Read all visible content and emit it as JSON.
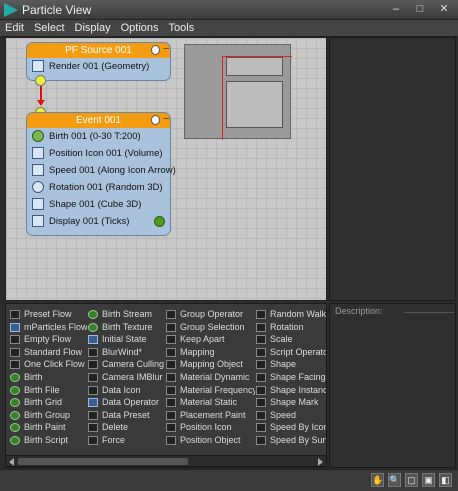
{
  "window": {
    "title": "Particle View"
  },
  "window_buttons": {
    "minimize": "–",
    "maximize": "□",
    "close": "✕"
  },
  "menu": [
    "Edit",
    "Select",
    "Display",
    "Options",
    "Tools"
  ],
  "nodes": {
    "source": {
      "title": "PF Source 001",
      "operators": [
        {
          "label": "Render 001 (Geometry)",
          "icon": "render-icon"
        }
      ]
    },
    "event": {
      "title": "Event 001",
      "operators": [
        {
          "label": "Birth 001 (0-30 T:200)",
          "icon": "birth-icon"
        },
        {
          "label": "Position Icon 001 (Volume)",
          "icon": "position-icon"
        },
        {
          "label": "Speed 001 (Along Icon Arrow)",
          "icon": "speed-icon"
        },
        {
          "label": "Rotation 001 (Random 3D)",
          "icon": "rotation-icon"
        },
        {
          "label": "Shape 001 (Cube 3D)",
          "icon": "shape-icon"
        },
        {
          "label": "Display 001 (Ticks)",
          "icon": "display-icon"
        }
      ]
    }
  },
  "depot": {
    "columns": [
      [
        "Preset Flow",
        "mParticles Flow",
        "Empty Flow",
        "Standard Flow",
        "One Click Flow",
        "Birth",
        "Birth File",
        "Birth Grid",
        "Birth Group",
        "Birth Paint",
        "Birth Script"
      ],
      [
        "Birth Stream",
        "Birth Texture",
        "Initial State",
        "BlurWind*",
        "Camera Culling",
        "Camera IMBlur",
        "Data Icon",
        "Data Operator",
        "Data Preset",
        "Delete",
        "Force"
      ],
      [
        "Group Operator",
        "Group Selection",
        "Keep Apart",
        "Mapping",
        "Mapping Object",
        "Material Dynamic",
        "Material Frequency",
        "Material Static",
        "Placement Paint",
        "Position Icon",
        "Position Object"
      ],
      [
        "Random Walk*",
        "Rotation",
        "Scale",
        "Script Operator",
        "Shape",
        "Shape Facing",
        "Shape Instance",
        "Shape Mark",
        "Speed",
        "Speed By Icon",
        "Speed By Surface"
      ]
    ]
  },
  "description": {
    "label": "Description:"
  },
  "status_tools": [
    "pan-icon",
    "zoom-icon",
    "zoom-region-icon",
    "zoom-extents-icon",
    "no-zoom-icon"
  ],
  "colors": {
    "node_header": "#f39c12",
    "node_body": "#a9c3dd",
    "wire": "#dd1111",
    "port": "#e8f23a"
  }
}
